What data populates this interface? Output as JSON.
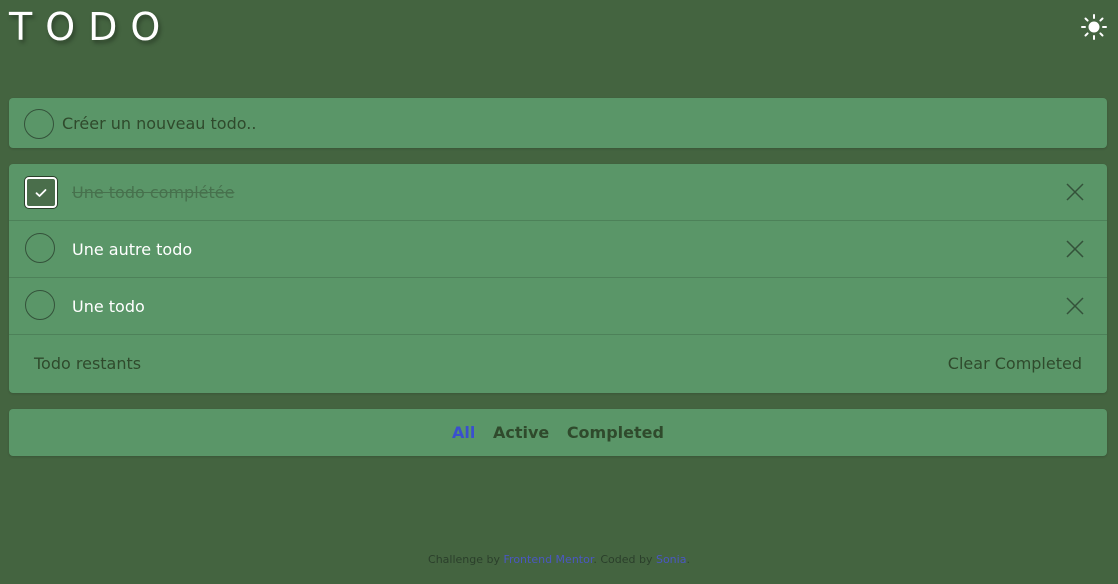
{
  "header": {
    "title": "TODO",
    "theme_icon": "sun-icon"
  },
  "new_todo": {
    "placeholder": "Créer un nouveau todo.."
  },
  "todos": [
    {
      "text": "Une todo complétée",
      "completed": true
    },
    {
      "text": "Une autre todo",
      "completed": false
    },
    {
      "text": "Une todo",
      "completed": false
    }
  ],
  "list_footer": {
    "remaining_label": "Todo restants",
    "clear_label": "Clear Completed"
  },
  "filters": {
    "all": "All",
    "active": "Active",
    "completed": "Completed",
    "selected": "All"
  },
  "attribution": {
    "prefix": "Challenge by",
    "challenge_link": "Frontend Mentor",
    "middle": ". Coded by",
    "author_link": "Sonia",
    "suffix": "."
  },
  "colors": {
    "background": "#446440",
    "card": "#5a9668",
    "accent": "#3a4fcf"
  }
}
